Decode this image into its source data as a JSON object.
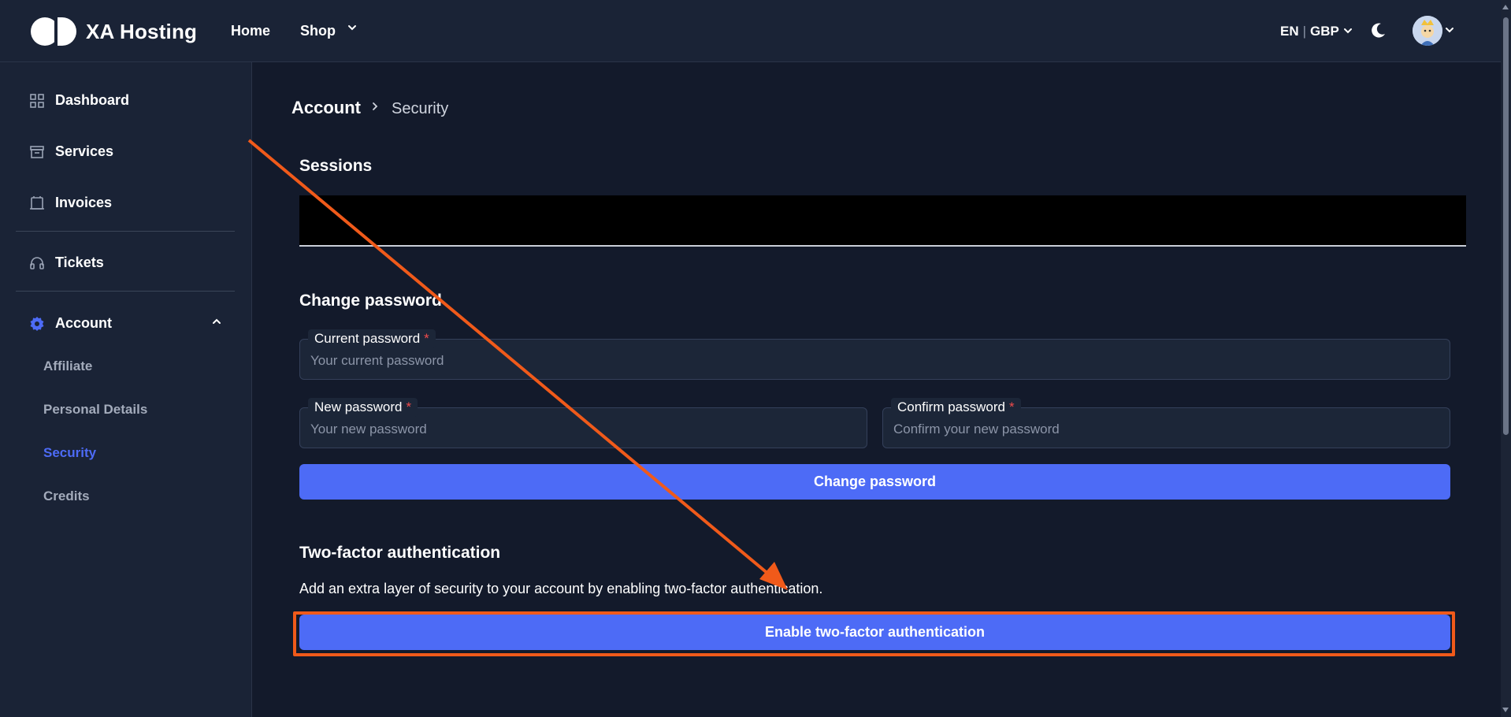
{
  "header": {
    "brand": "XA Hosting",
    "nav": {
      "home": "Home",
      "shop": "Shop"
    },
    "language": "EN",
    "separator": "|",
    "currency": "GBP"
  },
  "sidebar": {
    "items": [
      {
        "label": "Dashboard",
        "icon": "dashboard-grid-icon"
      },
      {
        "label": "Services",
        "icon": "services-box-icon"
      },
      {
        "label": "Invoices",
        "icon": "invoice-icon"
      },
      {
        "label": "Tickets",
        "icon": "headset-icon"
      },
      {
        "label": "Account",
        "icon": "gear-icon"
      }
    ],
    "account_sub": [
      {
        "label": "Affiliate"
      },
      {
        "label": "Personal Details"
      },
      {
        "label": "Security",
        "active": true
      },
      {
        "label": "Credits"
      }
    ]
  },
  "breadcrumb": {
    "parent": "Account",
    "current": "Security"
  },
  "sessions": {
    "title": "Sessions"
  },
  "change_password": {
    "title": "Change password",
    "current": {
      "label": "Current password",
      "required": "*",
      "placeholder": "Your current password"
    },
    "new": {
      "label": "New password",
      "required": "*",
      "placeholder": "Your new password"
    },
    "confirm": {
      "label": "Confirm password",
      "required": "*",
      "placeholder": "Confirm your new password"
    },
    "button": "Change password"
  },
  "two_factor": {
    "title": "Two-factor authentication",
    "description": "Add an extra layer of security to your account by enabling two-factor authentication.",
    "button": "Enable two-factor authentication"
  },
  "colors": {
    "accent": "#4d6bf6",
    "annotation": "#f05a1a",
    "background": "#131a2b",
    "panel": "#1a2336"
  }
}
